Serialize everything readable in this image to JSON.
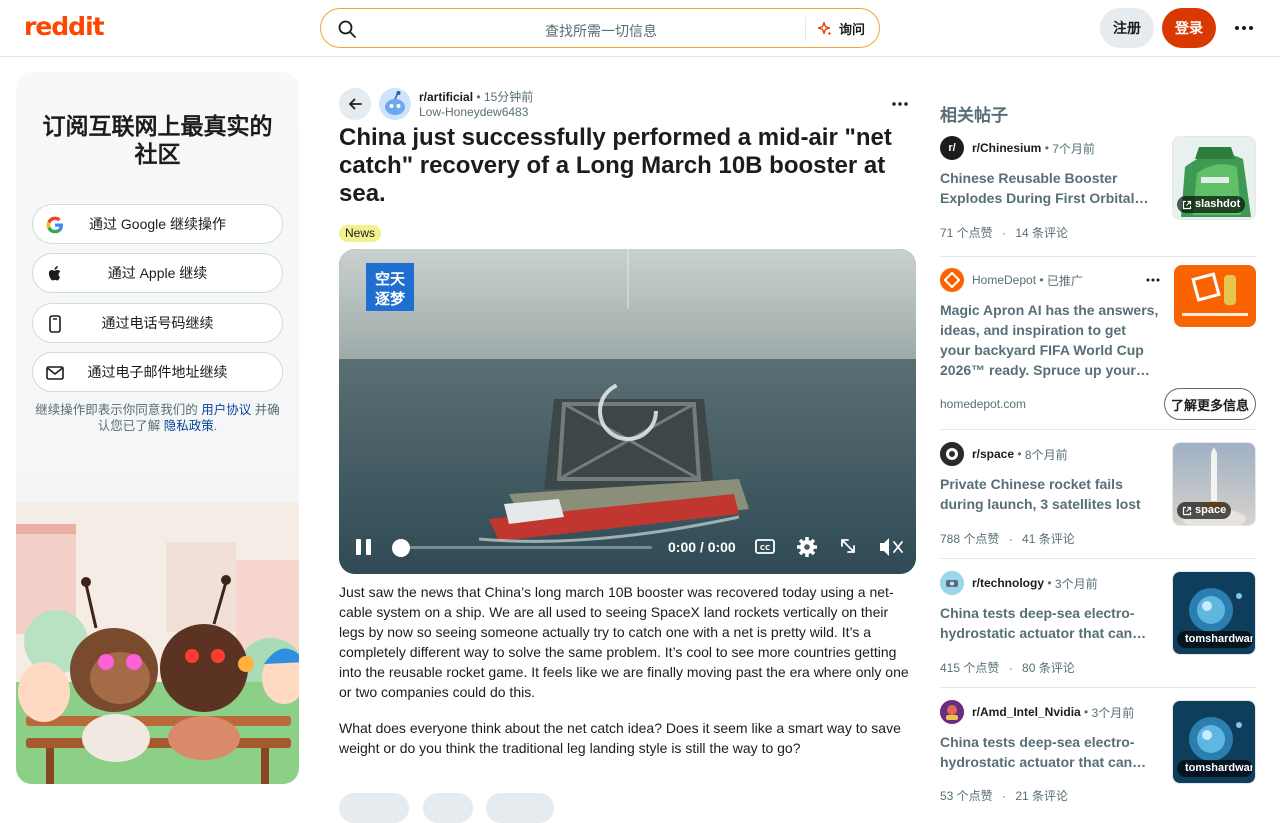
{
  "header": {
    "logo": "reddit",
    "search_placeholder": "查找所需一切信息",
    "ask_label": "询问",
    "signup_label": "注册",
    "login_label": "登录",
    "accent_color": "#d93900"
  },
  "left_card": {
    "title": "订阅互联网上最真实的社区",
    "auth_buttons": [
      {
        "label": "通过 Google 继续操作",
        "icon": "google-icon"
      },
      {
        "label": "通过 Apple 继续",
        "icon": "apple-icon"
      },
      {
        "label": "通过电话号码继续",
        "icon": "phone-icon"
      },
      {
        "label": "通过电子邮件地址继续",
        "icon": "mail-icon"
      }
    ],
    "legal_prefix": "继续操作即表示你同意我们的",
    "legal_terms": "用户协议",
    "legal_mid": "并确认您已了解",
    "legal_privacy": "隐私政策",
    "legal_suffix": "."
  },
  "post": {
    "subreddit": "r/artificial",
    "time": "15分钟前",
    "author": "Low-Honeydew6483",
    "title": "China just successfully performed a mid-air \"net catch\" recovery of a Long March 10B booster at sea.",
    "flair": "News",
    "video": {
      "time_display": "0:00 / 0:00",
      "progress": 0,
      "watermark": "空天\n逐梦"
    },
    "body": [
      "Just saw the news that China’s long march 10B booster was recovered today using a net-cable system on a ship. We are all used to seeing SpaceX land rockets vertically on their legs by now so seeing someone actually try to catch one with a net is pretty wild. It’s a completely different way to solve the same problem. It’s cool to see more countries getting into the reusable rocket game. It feels like we are finally moving past the era where only one or two companies could do this.",
      "What does everyone think about the net catch idea? Does it seem like a smart way to save weight or do you think the traditional leg landing style is still the way to go?"
    ]
  },
  "related": {
    "title": "相关帖子",
    "items": [
      {
        "subreddit": "r/Chinesium",
        "time": "7个月前",
        "headline": "Chinese Reusable Booster Explodes During First Orbital Launch Attempt",
        "upvotes": "71 个点赞",
        "comments": "14 条评论",
        "thumb_tag": "slashdot"
      },
      {
        "subreddit": "r/space",
        "time": "8个月前",
        "headline": "Private Chinese rocket fails during launch, 3 satellites lost",
        "upvotes": "788 个点赞",
        "comments": "41 条评论",
        "thumb_tag": "space"
      },
      {
        "subreddit": "r/technology",
        "time": "3个月前",
        "headline": "China tests deep-sea electro-hydrostatic actuator that can conquer ocean depths",
        "upvotes": "415 个点赞",
        "comments": "80 条评论",
        "thumb_tag": "tomshardware.com"
      },
      {
        "subreddit": "r/Amd_Intel_Nvidia",
        "time": "3个月前",
        "headline": "China tests deep-sea electro-hydrostatic actuator that can conquer ocean depths",
        "upvotes": "53 个点赞",
        "comments": "21 条评论",
        "thumb_tag": "tomshardware.com"
      }
    ],
    "ad": {
      "advertiser": "HomeDepot",
      "promoted": "已推广",
      "headline": "Magic Apron AI has the answers, ideas, and inspiration to get your backyard FIFA World Cup 2026™ ready. Spruce up your home turf today.",
      "domain": "homedepot.com",
      "cta": "了解更多信息"
    },
    "separator": "·"
  }
}
